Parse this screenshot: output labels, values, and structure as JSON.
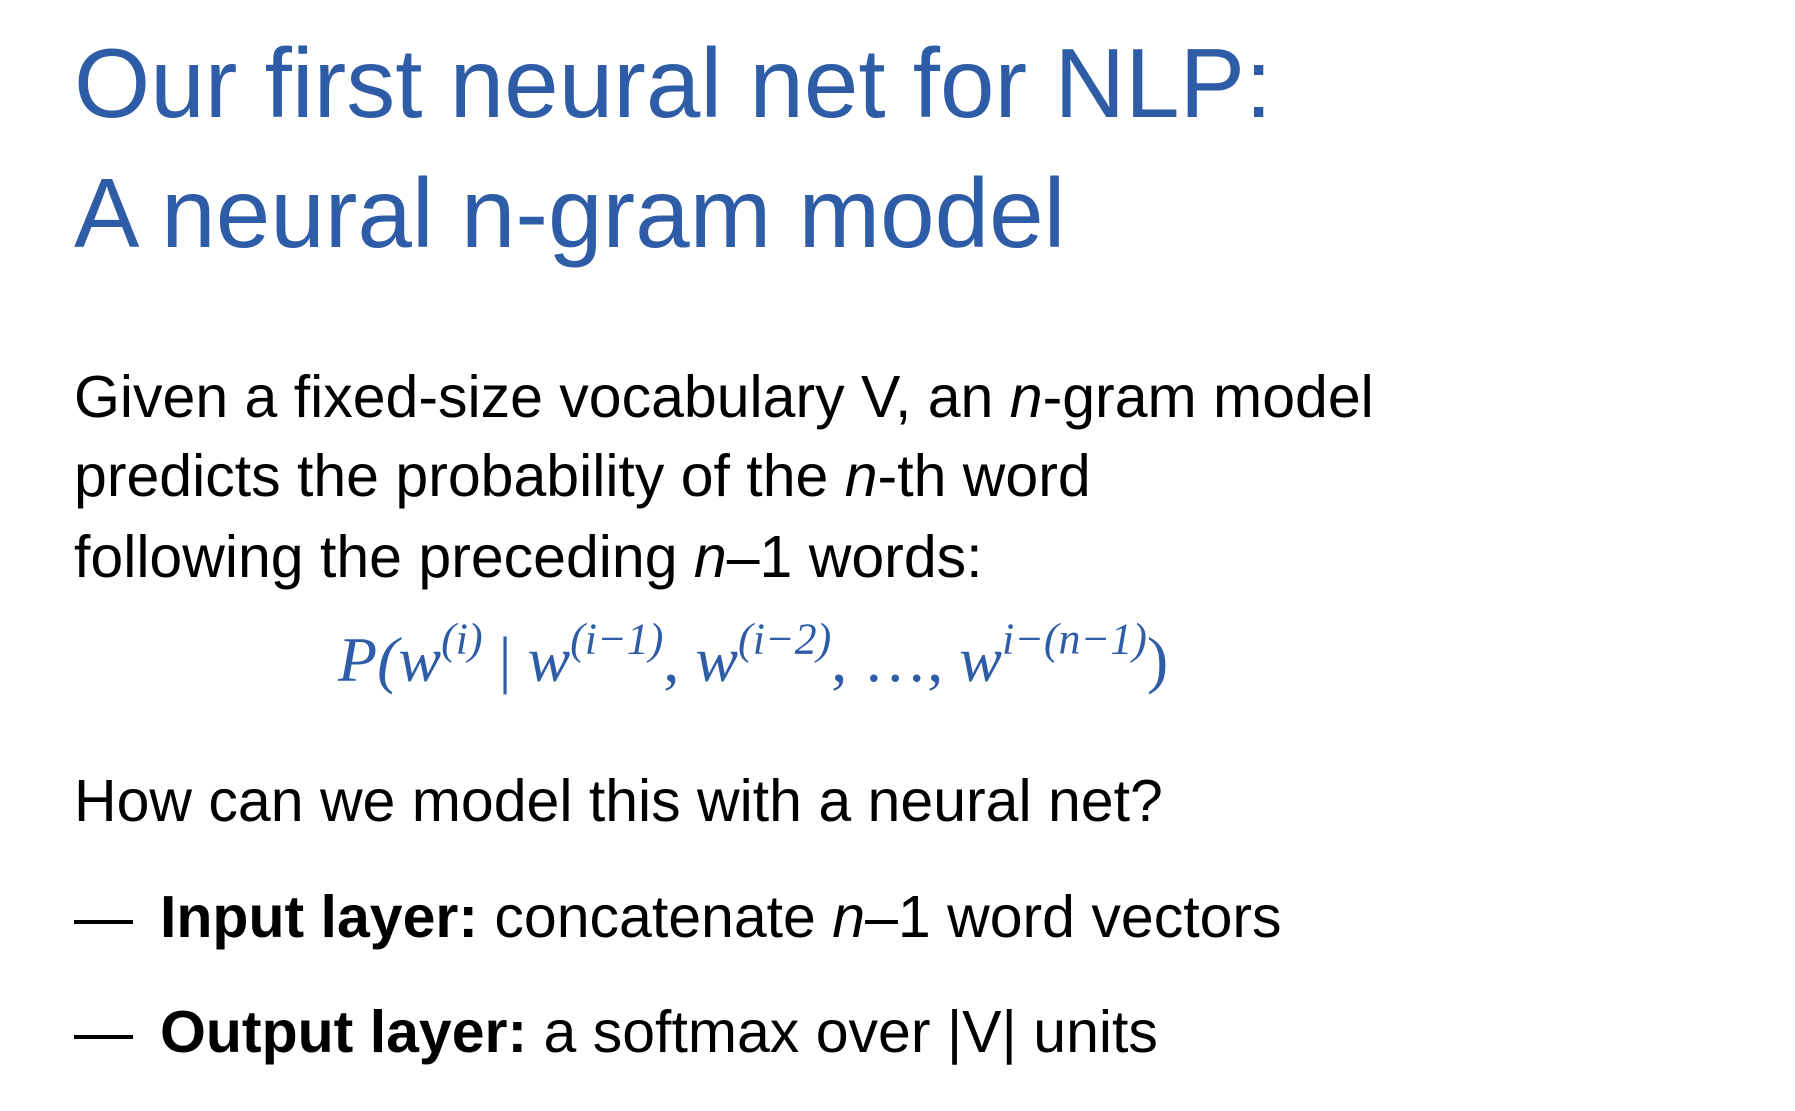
{
  "title": {
    "line1": "Our first neural net for NLP:",
    "line2": "A neural n-gram model"
  },
  "intro": {
    "line1_a": "Given a fixed-size vocabulary V, an ",
    "line1_n": "n",
    "line1_b": "-gram model",
    "line2_a": "predicts the probability of the ",
    "line2_n": "n",
    "line2_b": "-th word",
    "line3_a": "following the preceding ",
    "line3_n": "n",
    "line3_b": "–1 words:"
  },
  "formula": {
    "p_open": "P(w",
    "sup_i": "(i)",
    "bar": " | ",
    "w1": "w",
    "sup_i1": "(i−1)",
    "comma1": ", ",
    "w2": "w",
    "sup_i2": "(i−2)",
    "dots": ", …, ",
    "w3": "w",
    "sup_in": "i−(n−1)",
    "close": ")"
  },
  "question": "How can we model this with a neural net?",
  "bullets": [
    {
      "dash": "—",
      "label": "Input layer:",
      "text_a": " concatenate ",
      "text_n": "n",
      "text_b": "–1 word vectors"
    },
    {
      "dash": "—",
      "label": "Output layer:",
      "text_a": " a softmax over |V| units"
    }
  ],
  "colors": {
    "title": "#2e5ca6",
    "formula": "#2e5ca6",
    "text": "#000000",
    "background": "#ffffff"
  }
}
